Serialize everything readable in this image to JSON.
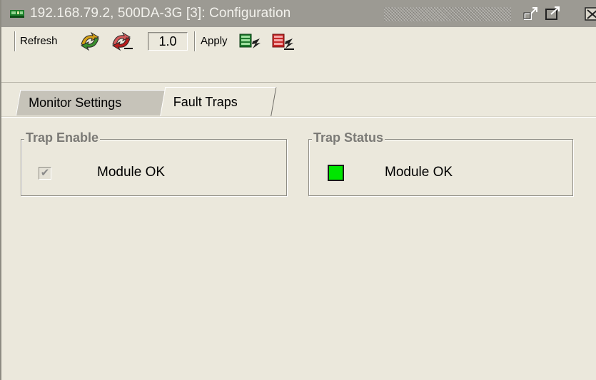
{
  "window": {
    "title": "192.168.79.2, 500DA-3G  [3]: Configuration",
    "icons": {
      "app": "network-card-icon",
      "undock": "undock-icon",
      "maximize": "maximize-icon",
      "close": "close-icon"
    }
  },
  "toolbar": {
    "refresh_label": "Refresh",
    "version_value": "1.0",
    "apply_label": "Apply",
    "icons": {
      "refresh": "refresh-icon",
      "refresh_stop": "refresh-stop-icon",
      "apply": "apply-icon",
      "apply_stop": "apply-stop-icon"
    }
  },
  "tabs": [
    {
      "label": "Monitor Settings",
      "selected": false
    },
    {
      "label": "Fault Traps",
      "selected": true
    }
  ],
  "trap_enable": {
    "title": "Trap Enable",
    "items": [
      {
        "label": "Module OK",
        "checked": true,
        "disabled": true
      }
    ]
  },
  "trap_status": {
    "title": "Trap Status",
    "items": [
      {
        "label": "Module OK",
        "state": "ok",
        "color": "#00e600"
      }
    ]
  }
}
